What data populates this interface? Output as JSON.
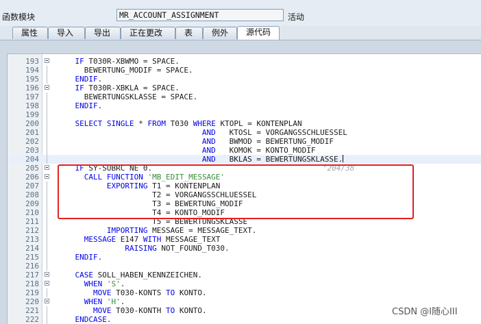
{
  "function_module": {
    "label": "函数模块",
    "name": "MR_ACCOUNT_ASSIGNMENT",
    "status": "活动"
  },
  "tabs": [
    {
      "label": "属性",
      "active": false
    },
    {
      "label": "导入",
      "active": false
    },
    {
      "label": "导出",
      "active": false
    },
    {
      "label": "正在更改",
      "active": false
    },
    {
      "label": "表",
      "active": false
    },
    {
      "label": "例外",
      "active": false
    },
    {
      "label": "源代码",
      "active": true
    }
  ],
  "code_lines": [
    {
      "n": "193",
      "fold": true,
      "parts": [
        [
          "    ",
          ""
        ],
        [
          "IF",
          "kw"
        ],
        [
          " T030R-XBWMO = SPACE.",
          ""
        ]
      ]
    },
    {
      "n": "194",
      "fold": false,
      "parts": [
        [
          "      BEWERTUNG_MODIF = SPACE.",
          ""
        ]
      ]
    },
    {
      "n": "195",
      "fold": false,
      "parts": [
        [
          "    ",
          ""
        ],
        [
          "ENDIF",
          "kw"
        ],
        [
          ".",
          ""
        ]
      ]
    },
    {
      "n": "196",
      "fold": true,
      "parts": [
        [
          "    ",
          ""
        ],
        [
          "IF",
          "kw"
        ],
        [
          " T030R-XBKLA = SPACE.",
          ""
        ]
      ]
    },
    {
      "n": "197",
      "fold": false,
      "parts": [
        [
          "      BEWERTUNGSKLASSE = SPACE.",
          ""
        ]
      ]
    },
    {
      "n": "198",
      "fold": false,
      "parts": [
        [
          "    ",
          ""
        ],
        [
          "ENDIF",
          "kw"
        ],
        [
          ".",
          ""
        ]
      ]
    },
    {
      "n": "199",
      "fold": false,
      "parts": [
        [
          "",
          ""
        ]
      ]
    },
    {
      "n": "200",
      "fold": false,
      "parts": [
        [
          "    ",
          ""
        ],
        [
          "SELECT SINGLE",
          "kw"
        ],
        [
          " * ",
          ""
        ],
        [
          "FROM",
          "kw"
        ],
        [
          " T030 ",
          ""
        ],
        [
          "WHERE",
          "kw"
        ],
        [
          " KTOPL = KONTENPLAN",
          ""
        ]
      ]
    },
    {
      "n": "201",
      "fold": false,
      "parts": [
        [
          "                                ",
          ""
        ],
        [
          "AND",
          "kw"
        ],
        [
          "   KTOSL = VORGANGSSCHLUESSEL",
          ""
        ]
      ]
    },
    {
      "n": "202",
      "fold": false,
      "parts": [
        [
          "                                ",
          ""
        ],
        [
          "AND",
          "kw"
        ],
        [
          "   BWMOD = BEWERTUNG_MODIF",
          ""
        ]
      ]
    },
    {
      "n": "203",
      "fold": false,
      "parts": [
        [
          "                                ",
          ""
        ],
        [
          "AND",
          "kw"
        ],
        [
          "   KOMOK = KONTO_MODIF",
          ""
        ]
      ]
    },
    {
      "n": "204",
      "fold": false,
      "cursor": true,
      "parts": [
        [
          "                                ",
          ""
        ],
        [
          "AND",
          "kw"
        ],
        [
          "   BKLAS = BEWERTUNGSKLASSE.",
          ""
        ]
      ]
    },
    {
      "n": "205",
      "fold": true,
      "parts": [
        [
          "    ",
          ""
        ],
        [
          "IF",
          "kw"
        ],
        [
          " SY-SUBRC NE 0.",
          ""
        ]
      ]
    },
    {
      "n": "206",
      "fold": true,
      "parts": [
        [
          "      ",
          ""
        ],
        [
          "CALL FUNCTION",
          "kw"
        ],
        [
          " ",
          ""
        ],
        [
          "'MB_EDIT_MESSAGE'",
          "str"
        ]
      ]
    },
    {
      "n": "207",
      "fold": false,
      "parts": [
        [
          "           ",
          ""
        ],
        [
          "EXPORTING",
          "kw"
        ],
        [
          " T1 = KONTENPLAN",
          ""
        ]
      ]
    },
    {
      "n": "208",
      "fold": false,
      "parts": [
        [
          "                     T2 = VORGANGSSCHLUESSEL",
          ""
        ]
      ]
    },
    {
      "n": "209",
      "fold": false,
      "parts": [
        [
          "                     T3 = BEWERTUNG_MODIF",
          ""
        ]
      ]
    },
    {
      "n": "210",
      "fold": false,
      "parts": [
        [
          "                     T4 = KONTO_MODIF",
          ""
        ]
      ]
    },
    {
      "n": "211",
      "fold": false,
      "parts": [
        [
          "                     T5 = BEWERTUNGSKLASSE",
          ""
        ]
      ]
    },
    {
      "n": "212",
      "fold": false,
      "parts": [
        [
          "           ",
          ""
        ],
        [
          "IMPORTING",
          "kw"
        ],
        [
          " MESSAGE = MESSAGE_TEXT.",
          ""
        ]
      ]
    },
    {
      "n": "213",
      "fold": false,
      "parts": [
        [
          "      ",
          ""
        ],
        [
          "MESSAGE",
          "kw"
        ],
        [
          " E147 ",
          ""
        ],
        [
          "WITH",
          "kw"
        ],
        [
          " MESSAGE_TEXT",
          ""
        ]
      ]
    },
    {
      "n": "214",
      "fold": false,
      "parts": [
        [
          "               ",
          ""
        ],
        [
          "RAISING",
          "kw"
        ],
        [
          " NOT_FOUND_T030.",
          ""
        ]
      ]
    },
    {
      "n": "215",
      "fold": false,
      "parts": [
        [
          "    ",
          ""
        ],
        [
          "ENDIF",
          "kw"
        ],
        [
          ".",
          ""
        ]
      ]
    },
    {
      "n": "216",
      "fold": false,
      "parts": [
        [
          "",
          ""
        ]
      ]
    },
    {
      "n": "217",
      "fold": true,
      "parts": [
        [
          "    ",
          ""
        ],
        [
          "CASE",
          "kw"
        ],
        [
          " SOLL_HABEN_KENNZEICHEN.",
          ""
        ]
      ]
    },
    {
      "n": "218",
      "fold": true,
      "parts": [
        [
          "      ",
          ""
        ],
        [
          "WHEN",
          "kw"
        ],
        [
          " ",
          ""
        ],
        [
          "'S'",
          "str"
        ],
        [
          ".",
          ""
        ]
      ]
    },
    {
      "n": "219",
      "fold": false,
      "parts": [
        [
          "        ",
          ""
        ],
        [
          "MOVE",
          "kw"
        ],
        [
          " T030-KONTS ",
          ""
        ],
        [
          "TO",
          "kw"
        ],
        [
          " KONTO.",
          ""
        ]
      ]
    },
    {
      "n": "220",
      "fold": true,
      "parts": [
        [
          "      ",
          ""
        ],
        [
          "WHEN",
          "kw"
        ],
        [
          " ",
          ""
        ],
        [
          "'H'",
          "str"
        ],
        [
          ".",
          ""
        ]
      ]
    },
    {
      "n": "221",
      "fold": false,
      "parts": [
        [
          "        ",
          ""
        ],
        [
          "MOVE",
          "kw"
        ],
        [
          " T030-KONTH ",
          ""
        ],
        [
          "TO",
          "kw"
        ],
        [
          " KONTO.",
          ""
        ]
      ]
    },
    {
      "n": "222",
      "fold": false,
      "parts": [
        [
          "    ",
          ""
        ],
        [
          "ENDCASE",
          "kw"
        ],
        [
          ".",
          ""
        ]
      ]
    }
  ],
  "ghost_hint": "\"204/38",
  "watermark": "CSDN @I随心III",
  "colors": {
    "keyword": "#0000e6",
    "string": "#3a8c3a",
    "highlight_box": "#e0201f"
  }
}
